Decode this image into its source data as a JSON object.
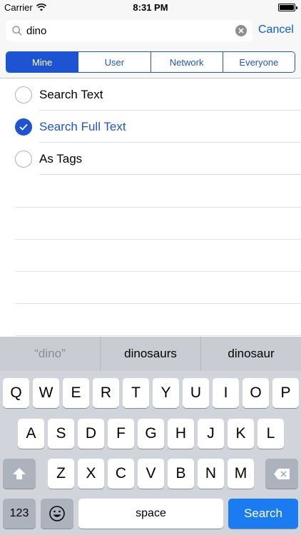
{
  "status_bar": {
    "carrier": "Carrier",
    "time": "8:31 PM"
  },
  "search": {
    "query": "dino",
    "cancel_label": "Cancel"
  },
  "scope_tabs": [
    {
      "label": "Mine",
      "selected": true
    },
    {
      "label": "User",
      "selected": false
    },
    {
      "label": "Network",
      "selected": false
    },
    {
      "label": "Everyone",
      "selected": false
    }
  ],
  "options": [
    {
      "label": "Search Text",
      "checked": false
    },
    {
      "label": "Search Full Text",
      "checked": true
    },
    {
      "label": "As Tags",
      "checked": false
    }
  ],
  "keyboard": {
    "suggestions": [
      "“dino”",
      "dinosaurs",
      "dinosaur"
    ],
    "row1": [
      "Q",
      "W",
      "E",
      "R",
      "T",
      "Y",
      "U",
      "I",
      "O",
      "P"
    ],
    "row2": [
      "A",
      "S",
      "D",
      "F",
      "G",
      "H",
      "J",
      "K",
      "L"
    ],
    "row3": [
      "Z",
      "X",
      "C",
      "V",
      "B",
      "N",
      "M"
    ],
    "numbers_label": "123",
    "space_label": "space",
    "search_label": "Search",
    "shift_icon": "shift-arrow-icon",
    "delete_icon": "backspace-icon",
    "emoji_icon": "emoji-face-icon"
  },
  "colors": {
    "accent": "#1e54d1",
    "link": "#0a5ce6",
    "search_key": "#1a7cf0",
    "keyboard_bg": "#d1d5db"
  }
}
